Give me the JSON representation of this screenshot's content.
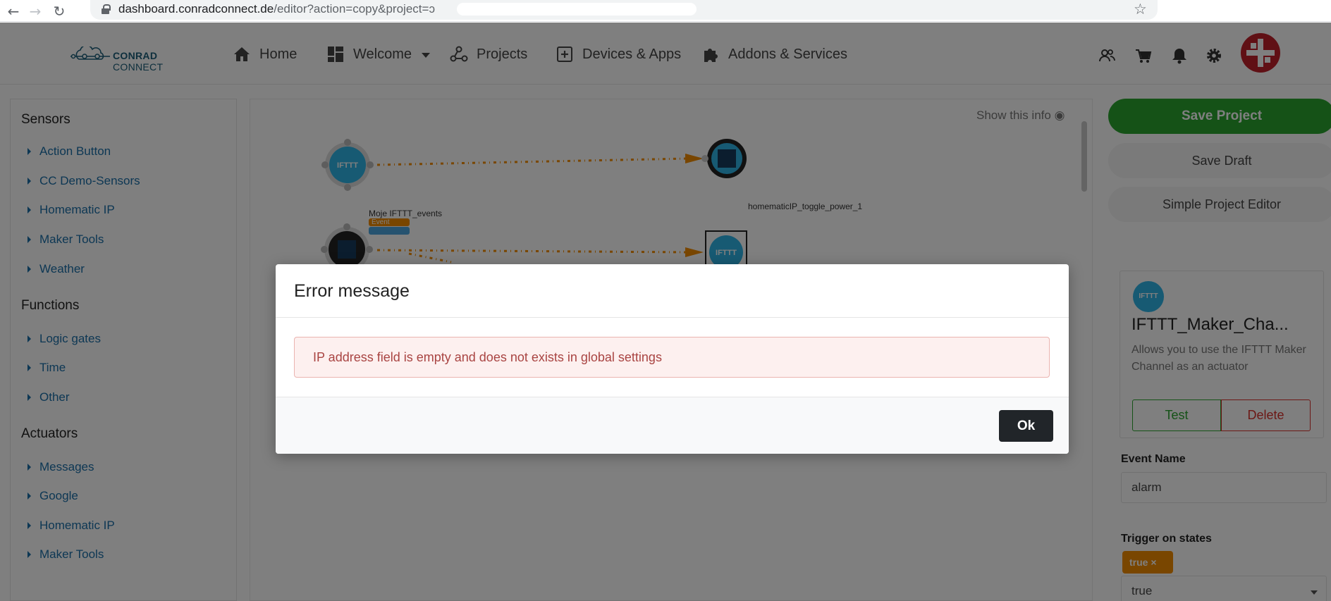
{
  "browser": {
    "url_host": "dashboard.conradconnect.de",
    "url_path": "/editor?action=copy&project=",
    "url_suffix": "ɔ"
  },
  "topnav": {
    "logo_text_bold": "CONRAD",
    "logo_text_thin": "CONNECT",
    "items": [
      {
        "label": "Home",
        "icon": "home-icon"
      },
      {
        "label": "Welcome",
        "icon": "dashboard-icon"
      },
      {
        "label": "Projects",
        "icon": "projects-icon"
      },
      {
        "label": "Devices & Apps",
        "icon": "plus-square-icon"
      },
      {
        "label": "Addons & Services",
        "icon": "puzzle-icon"
      }
    ],
    "right_icons": [
      "users-icon",
      "cart-icon",
      "bell-icon",
      "gear-icon"
    ]
  },
  "sidebar": {
    "sections": [
      {
        "title": "Sensors",
        "items": [
          "Action Button",
          "CC Demo-Sensors",
          "Homematic IP",
          "Maker Tools",
          "Weather"
        ]
      },
      {
        "title": "Functions",
        "items": [
          "Logic gates",
          "Time",
          "Other"
        ]
      },
      {
        "title": "Actuators",
        "items": [
          "Messages",
          "Google",
          "Homematic IP",
          "Maker Tools"
        ]
      }
    ]
  },
  "canvas": {
    "show_info": "Show this info",
    "node1_icon": "IFTTT",
    "node1_label": "Moje IFTTT_events",
    "node1_tag": "Event",
    "node2_label": "homematicIP_toggle_power_1",
    "node4_icon": "IFTTT"
  },
  "rightpanel": {
    "save_project": "Save Project",
    "save_draft": "Save Draft",
    "simple_editor": "Simple Project Editor",
    "card_icon": "IFTTT",
    "card_title": "IFTTT_Maker_Cha...",
    "card_desc": "Allows you to use the IFTTT Maker Channel as an actuator",
    "test": "Test",
    "delete": "Delete",
    "event_name_label": "Event Name",
    "event_name_value": "alarm",
    "trigger_label": "Trigger on states",
    "trigger_chip": "true",
    "trigger_select": "true"
  },
  "modal": {
    "title": "Error message",
    "message": "IP address field is empty and does not exists in global settings",
    "ok": "Ok"
  },
  "colors": {
    "save_green": "#2aa52f",
    "delete_red": "#d9312b",
    "link_blue": "#1a6fa8",
    "error_text": "#a94442",
    "accent_orange": "#f28c00"
  }
}
